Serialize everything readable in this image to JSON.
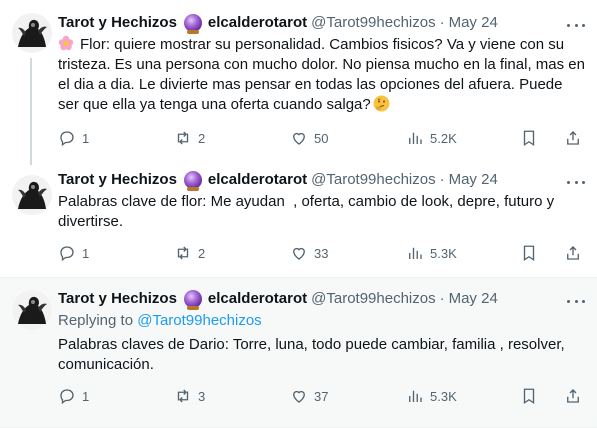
{
  "tweets": [
    {
      "name": "Tarot y Hechizos",
      "name_icon": "crystal-ball-icon",
      "handle_bold": "elcalderotarot",
      "handle": "@Tarot99hechizos",
      "dot": "·",
      "date": "May 24",
      "body_prefix_icon": "flower-emoji",
      "body": "Flor: quiere mostrar su personalidad. Cambios fisicos? Va y viene con su tristeza. Es una persona con mucho dolor. No piensa mucho en la final, mas en el dia a dia. Le divierte mas pensar en todas las opciones del afuera. Puede ser que ella ya tenga una oferta cuando salga?",
      "body_suffix_icon": "thinking-face-emoji",
      "replies": "1",
      "retweets": "2",
      "likes": "50",
      "views": "5.2K"
    },
    {
      "name": "Tarot y Hechizos",
      "name_icon": "crystal-ball-icon",
      "handle_bold": "elcalderotarot",
      "handle": "@Tarot99hechizos",
      "dot": "·",
      "date": "May 24",
      "body": "Palabras clave de flor: Me ayudan  , oferta, cambio de look, depre, futuro y divertirse.",
      "replies": "1",
      "retweets": "2",
      "likes": "33",
      "views": "5.3K"
    },
    {
      "name": "Tarot y Hechizos",
      "name_icon": "crystal-ball-icon",
      "handle_bold": "elcalderotarot",
      "handle": "@Tarot99hechizos",
      "dot": "·",
      "date": "May 24",
      "replying_label": "Replying to",
      "replying_to": "@Tarot99hechizos",
      "body": "Palabras claves de Dario: Torre, luna, todo puede cambiar, familia , resolver, comunicación.",
      "replies": "1",
      "retweets": "3",
      "likes": "37",
      "views": "5.3K"
    }
  ],
  "colors": {
    "text": "#0f1419",
    "muted": "#536471",
    "link": "#1d9bf0",
    "thread_line": "#cfd9de",
    "highlight_bg": "#f7f9f9"
  }
}
